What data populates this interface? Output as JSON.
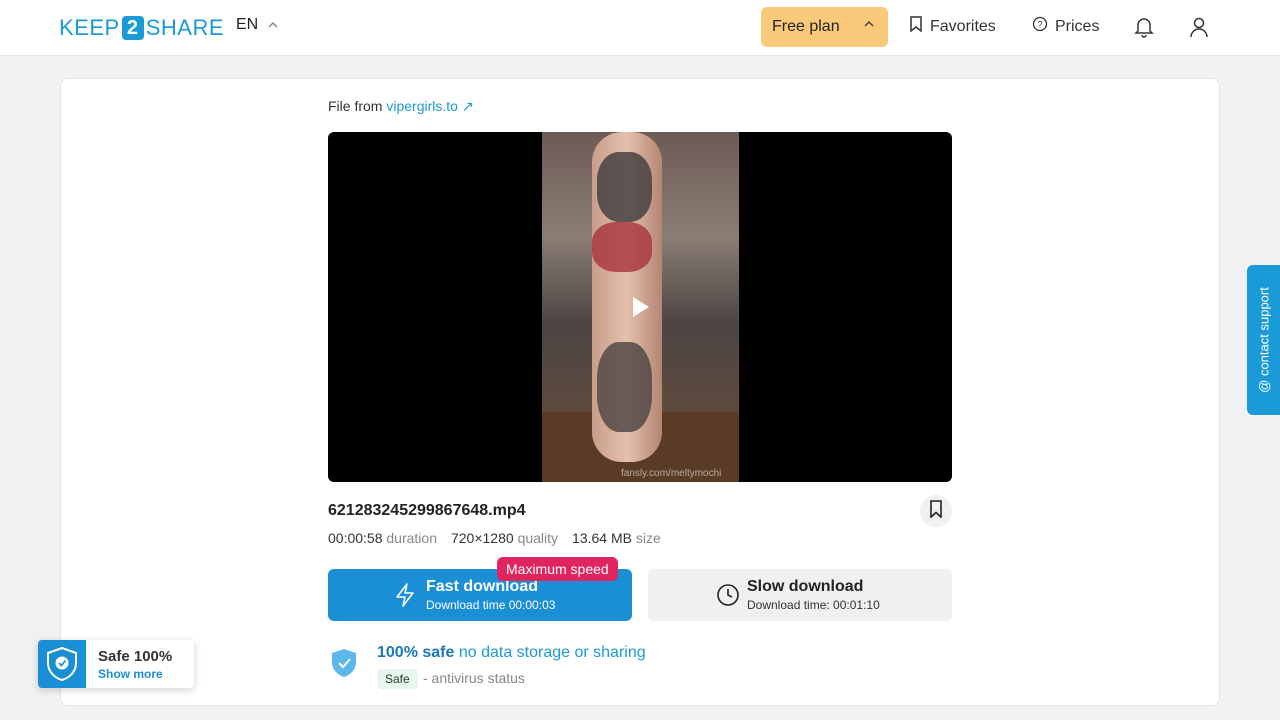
{
  "header": {
    "logo_left": "KEEP",
    "logo_mid": "2",
    "logo_right": "SHARE",
    "lang": "EN",
    "plan_label": "Free plan",
    "favorites_label": "Favorites",
    "prices_label": "Prices"
  },
  "file": {
    "from_prefix": "File from",
    "from_link": "vipergirls.to",
    "name": "621283245299867648.mp4",
    "duration_value": "00:00:58",
    "duration_label": "duration",
    "quality_value": "720×1280",
    "quality_label": "quality",
    "size_value": "13.64 MB",
    "size_label": "size",
    "watermark": "fansly.com/meltymochi"
  },
  "download": {
    "badge": "Maximum speed",
    "fast_title": "Fast download",
    "fast_time": "Download time 00:00:03",
    "slow_title": "Slow download",
    "slow_time": "Download time: 00:01:10"
  },
  "safety": {
    "strong": "100% safe",
    "rest": "no data storage or sharing",
    "badge": "Safe",
    "sub": "- antivirus status"
  },
  "widget": {
    "title": "Safe 100%",
    "link": "Show more"
  },
  "support": {
    "label": "@ contact support"
  },
  "colors": {
    "accent": "#1a9ad6",
    "plan": "#fbc97a",
    "badge": "#e0245e"
  }
}
